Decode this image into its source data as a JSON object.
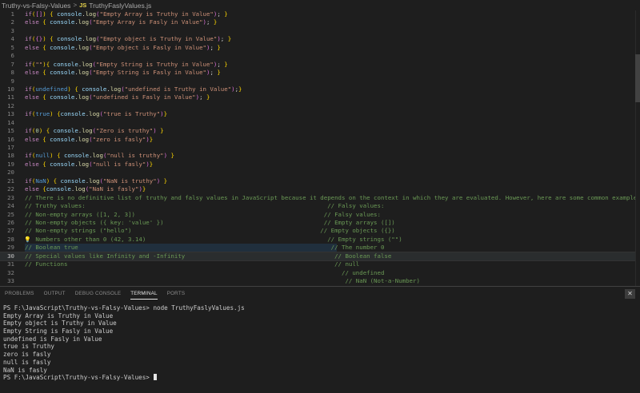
{
  "breadcrumb": {
    "folder": "Truthy-vs-Falsy-Values",
    "separator": ">",
    "file_badge": "JS",
    "file": "TruthyFaslyValues.js"
  },
  "editor": {
    "current_line": 30,
    "lines": [
      {
        "n": "1",
        "tokens": [
          [
            "kw",
            "if"
          ],
          [
            "br1",
            "("
          ],
          [
            "br2",
            "[]"
          ],
          [
            "br1",
            ")"
          ],
          [
            "pun",
            " "
          ],
          [
            "br1",
            "{"
          ],
          [
            "pun",
            " "
          ],
          [
            "var",
            "console"
          ],
          [
            "pun",
            "."
          ],
          [
            "fn",
            "log"
          ],
          [
            "br2",
            "("
          ],
          [
            "str",
            "\"Empty Array is Truthy in Value\""
          ],
          [
            "br2",
            ")"
          ],
          [
            "pun",
            "; "
          ],
          [
            "br1",
            "}"
          ]
        ]
      },
      {
        "n": "2",
        "tokens": [
          [
            "kw",
            "else"
          ],
          [
            "pun",
            " "
          ],
          [
            "br1",
            "{"
          ],
          [
            "pun",
            " "
          ],
          [
            "var",
            "console"
          ],
          [
            "pun",
            "."
          ],
          [
            "fn",
            "log"
          ],
          [
            "br2",
            "("
          ],
          [
            "str",
            "\"Empty Array is Fasly in Value\""
          ],
          [
            "br2",
            ")"
          ],
          [
            "pun",
            "; "
          ],
          [
            "br1",
            "}"
          ]
        ]
      },
      {
        "n": "3",
        "tokens": []
      },
      {
        "n": "4",
        "tokens": [
          [
            "kw",
            "if"
          ],
          [
            "br1",
            "("
          ],
          [
            "br2",
            "{}"
          ],
          [
            "br1",
            ")"
          ],
          [
            "pun",
            " "
          ],
          [
            "br1",
            "{"
          ],
          [
            "pun",
            " "
          ],
          [
            "var",
            "console"
          ],
          [
            "pun",
            "."
          ],
          [
            "fn",
            "log"
          ],
          [
            "br2",
            "("
          ],
          [
            "str",
            "\"Empty object is Truthy in Value\""
          ],
          [
            "br2",
            ")"
          ],
          [
            "pun",
            "; "
          ],
          [
            "br1",
            "}"
          ]
        ]
      },
      {
        "n": "5",
        "tokens": [
          [
            "kw",
            "else"
          ],
          [
            "pun",
            " "
          ],
          [
            "br1",
            "{"
          ],
          [
            "pun",
            " "
          ],
          [
            "var",
            "console"
          ],
          [
            "pun",
            "."
          ],
          [
            "fn",
            "log"
          ],
          [
            "br2",
            "("
          ],
          [
            "str",
            "\"Empty object is Fasly in Value\""
          ],
          [
            "br2",
            ")"
          ],
          [
            "pun",
            "; "
          ],
          [
            "br1",
            "}"
          ]
        ]
      },
      {
        "n": "6",
        "tokens": []
      },
      {
        "n": "7",
        "tokens": [
          [
            "kw",
            "if"
          ],
          [
            "br1",
            "("
          ],
          [
            "str",
            "\"\""
          ],
          [
            "br1",
            ")"
          ],
          [
            "br1",
            "{"
          ],
          [
            "pun",
            " "
          ],
          [
            "var",
            "console"
          ],
          [
            "pun",
            "."
          ],
          [
            "fn",
            "log"
          ],
          [
            "br2",
            "("
          ],
          [
            "str",
            "\"Empty String is Truthy in Value\""
          ],
          [
            "br2",
            ")"
          ],
          [
            "pun",
            "; "
          ],
          [
            "br1",
            "}"
          ]
        ]
      },
      {
        "n": "8",
        "tokens": [
          [
            "kw",
            "else"
          ],
          [
            "pun",
            " "
          ],
          [
            "br1",
            "{"
          ],
          [
            "pun",
            " "
          ],
          [
            "var",
            "console"
          ],
          [
            "pun",
            "."
          ],
          [
            "fn",
            "log"
          ],
          [
            "br2",
            "("
          ],
          [
            "str",
            "\"Empty String is Fasly in Value\""
          ],
          [
            "br2",
            ")"
          ],
          [
            "pun",
            "; "
          ],
          [
            "br1",
            "}"
          ]
        ]
      },
      {
        "n": "9",
        "tokens": []
      },
      {
        "n": "10",
        "tokens": [
          [
            "kw",
            "if"
          ],
          [
            "br1",
            "("
          ],
          [
            "ctl",
            "undefined"
          ],
          [
            "br1",
            ")"
          ],
          [
            "pun",
            " "
          ],
          [
            "br1",
            "{"
          ],
          [
            "pun",
            " "
          ],
          [
            "var",
            "console"
          ],
          [
            "pun",
            "."
          ],
          [
            "fn",
            "log"
          ],
          [
            "br2",
            "("
          ],
          [
            "str",
            "\"undefined is Truthy in Value\""
          ],
          [
            "br2",
            ")"
          ],
          [
            "pun",
            ";"
          ],
          [
            "br1",
            "}"
          ]
        ]
      },
      {
        "n": "11",
        "tokens": [
          [
            "kw",
            "else"
          ],
          [
            "pun",
            " "
          ],
          [
            "br1",
            "{"
          ],
          [
            "pun",
            " "
          ],
          [
            "var",
            "console"
          ],
          [
            "pun",
            "."
          ],
          [
            "fn",
            "log"
          ],
          [
            "br2",
            "("
          ],
          [
            "str",
            "\"undefined is Fasly in Value\""
          ],
          [
            "br2",
            ")"
          ],
          [
            "pun",
            "; "
          ],
          [
            "br1",
            "}"
          ]
        ]
      },
      {
        "n": "12",
        "tokens": []
      },
      {
        "n": "13",
        "tokens": [
          [
            "kw",
            "if"
          ],
          [
            "br1",
            "("
          ],
          [
            "ctl",
            "true"
          ],
          [
            "br1",
            ")"
          ],
          [
            "pun",
            " "
          ],
          [
            "br1",
            "{"
          ],
          [
            "var",
            "console"
          ],
          [
            "pun",
            "."
          ],
          [
            "fn",
            "log"
          ],
          [
            "br2",
            "("
          ],
          [
            "str",
            "\"true is Truthy\""
          ],
          [
            "br2",
            ")"
          ],
          [
            "br1",
            "}"
          ]
        ]
      },
      {
        "n": "14",
        "tokens": []
      },
      {
        "n": "15",
        "tokens": [
          [
            "kw",
            "if"
          ],
          [
            "br1",
            "("
          ],
          [
            "num",
            "0"
          ],
          [
            "br1",
            ")"
          ],
          [
            "pun",
            " "
          ],
          [
            "br1",
            "{"
          ],
          [
            "pun",
            " "
          ],
          [
            "var",
            "console"
          ],
          [
            "pun",
            "."
          ],
          [
            "fn",
            "log"
          ],
          [
            "br2",
            "("
          ],
          [
            "str",
            "\"Zero is truthy\""
          ],
          [
            "br2",
            ")"
          ],
          [
            "pun",
            " "
          ],
          [
            "br1",
            "}"
          ]
        ]
      },
      {
        "n": "16",
        "tokens": [
          [
            "kw",
            "else"
          ],
          [
            "pun",
            " "
          ],
          [
            "br1",
            "{"
          ],
          [
            "pun",
            " "
          ],
          [
            "var",
            "console"
          ],
          [
            "pun",
            "."
          ],
          [
            "fn",
            "log"
          ],
          [
            "br2",
            "("
          ],
          [
            "str",
            "\"zero is fasly\""
          ],
          [
            "br2",
            ")"
          ],
          [
            "br1",
            "}"
          ]
        ]
      },
      {
        "n": "17",
        "tokens": []
      },
      {
        "n": "18",
        "tokens": [
          [
            "kw",
            "if"
          ],
          [
            "br1",
            "("
          ],
          [
            "ctl",
            "null"
          ],
          [
            "br1",
            ")"
          ],
          [
            "pun",
            " "
          ],
          [
            "br1",
            "{"
          ],
          [
            "pun",
            " "
          ],
          [
            "var",
            "console"
          ],
          [
            "pun",
            "."
          ],
          [
            "fn",
            "log"
          ],
          [
            "br2",
            "("
          ],
          [
            "str",
            "\"null is truthy\""
          ],
          [
            "br2",
            ")"
          ],
          [
            "pun",
            " "
          ],
          [
            "br1",
            "}"
          ]
        ]
      },
      {
        "n": "19",
        "tokens": [
          [
            "kw",
            "else"
          ],
          [
            "pun",
            " "
          ],
          [
            "br1",
            "{"
          ],
          [
            "pun",
            " "
          ],
          [
            "var",
            "console"
          ],
          [
            "pun",
            "."
          ],
          [
            "fn",
            "log"
          ],
          [
            "br2",
            "("
          ],
          [
            "str",
            "\"null is fasly\""
          ],
          [
            "br2",
            ")"
          ],
          [
            "br1",
            "}"
          ]
        ]
      },
      {
        "n": "20",
        "tokens": []
      },
      {
        "n": "21",
        "tokens": [
          [
            "kw",
            "if"
          ],
          [
            "br1",
            "("
          ],
          [
            "ctl",
            "NaN"
          ],
          [
            "br1",
            ")"
          ],
          [
            "pun",
            " "
          ],
          [
            "br1",
            "{"
          ],
          [
            "pun",
            " "
          ],
          [
            "var",
            "console"
          ],
          [
            "pun",
            "."
          ],
          [
            "fn",
            "log"
          ],
          [
            "br2",
            "("
          ],
          [
            "str",
            "\"NaN is truthy\""
          ],
          [
            "br2",
            ")"
          ],
          [
            "pun",
            " "
          ],
          [
            "br1",
            "}"
          ]
        ]
      },
      {
        "n": "22",
        "tokens": [
          [
            "kw",
            "else"
          ],
          [
            "pun",
            " "
          ],
          [
            "br1",
            "{"
          ],
          [
            "var",
            "console"
          ],
          [
            "pun",
            "."
          ],
          [
            "fn",
            "log"
          ],
          [
            "br2",
            "("
          ],
          [
            "str",
            "\"NaN is fasly\""
          ],
          [
            "br2",
            ")"
          ],
          [
            "br1",
            "}"
          ]
        ]
      },
      {
        "n": "23",
        "tokens": [
          [
            "com",
            "// There is no definitive list of truthy and falsy values in JavaScript because it depends on the context in which they are evaluated. However, here are some common examples:"
          ]
        ]
      },
      {
        "n": "24",
        "tokens": [
          [
            "com",
            "// Truthy values:                                                                    // Falsy values:"
          ]
        ]
      },
      {
        "n": "25",
        "tokens": [
          [
            "com",
            "// Non-empty arrays ([1, 2, 3])                                                     // Falsy values:"
          ]
        ]
      },
      {
        "n": "26",
        "tokens": [
          [
            "com",
            "// Non-empty objects ({ key: 'value' })                                             // Empty arrays ([])"
          ]
        ]
      },
      {
        "n": "27",
        "tokens": [
          [
            "com",
            "// Non-empty strings (\"hello\")                                                     // Empty objects ({})"
          ]
        ]
      },
      {
        "n": "28",
        "bulb": true,
        "tokens": [
          [
            "com",
            "   Numbers other than 0 (42, 3.14)                                                   // Empty strings (\"\")"
          ]
        ]
      },
      {
        "n": "29",
        "tokens": [
          [
            "com",
            "// Boolean true                                                                       // The number 0"
          ]
        ]
      },
      {
        "n": "30",
        "tokens": [
          [
            "com",
            "// Special values like Infinity and -Infinity                                          // Boolean false"
          ]
        ]
      },
      {
        "n": "31",
        "tokens": [
          [
            "com",
            "// Functions                                                                           // null"
          ]
        ]
      },
      {
        "n": "32",
        "tokens": [
          [
            "com",
            "                                                                                         // undefined"
          ]
        ]
      },
      {
        "n": "33",
        "tokens": [
          [
            "com",
            "                                                                                          // NaN (Not-a-Number)"
          ]
        ]
      }
    ]
  },
  "panel": {
    "tabs": [
      {
        "label": "PROBLEMS",
        "active": false
      },
      {
        "label": "OUTPUT",
        "active": false
      },
      {
        "label": "DEBUG CONSOLE",
        "active": false
      },
      {
        "label": "TERMINAL",
        "active": true
      },
      {
        "label": "PORTS",
        "active": false
      }
    ],
    "close_glyph": "✕",
    "terminal": {
      "command_line": "PS F:\\JavaScript\\Truthy-vs-Falsy-Values> node TruthyFaslyValues.js",
      "output": [
        "Empty Array is Truthy in Value",
        "Empty object is Truthy in Value",
        "Empty String is Fasly in Value",
        "undefined is Fasly in Value",
        "true is Truthy",
        "zero is fasly",
        "null is fasly",
        "NaN is fasly"
      ],
      "prompt": "PS F:\\JavaScript\\Truthy-vs-Falsy-Values> "
    }
  }
}
